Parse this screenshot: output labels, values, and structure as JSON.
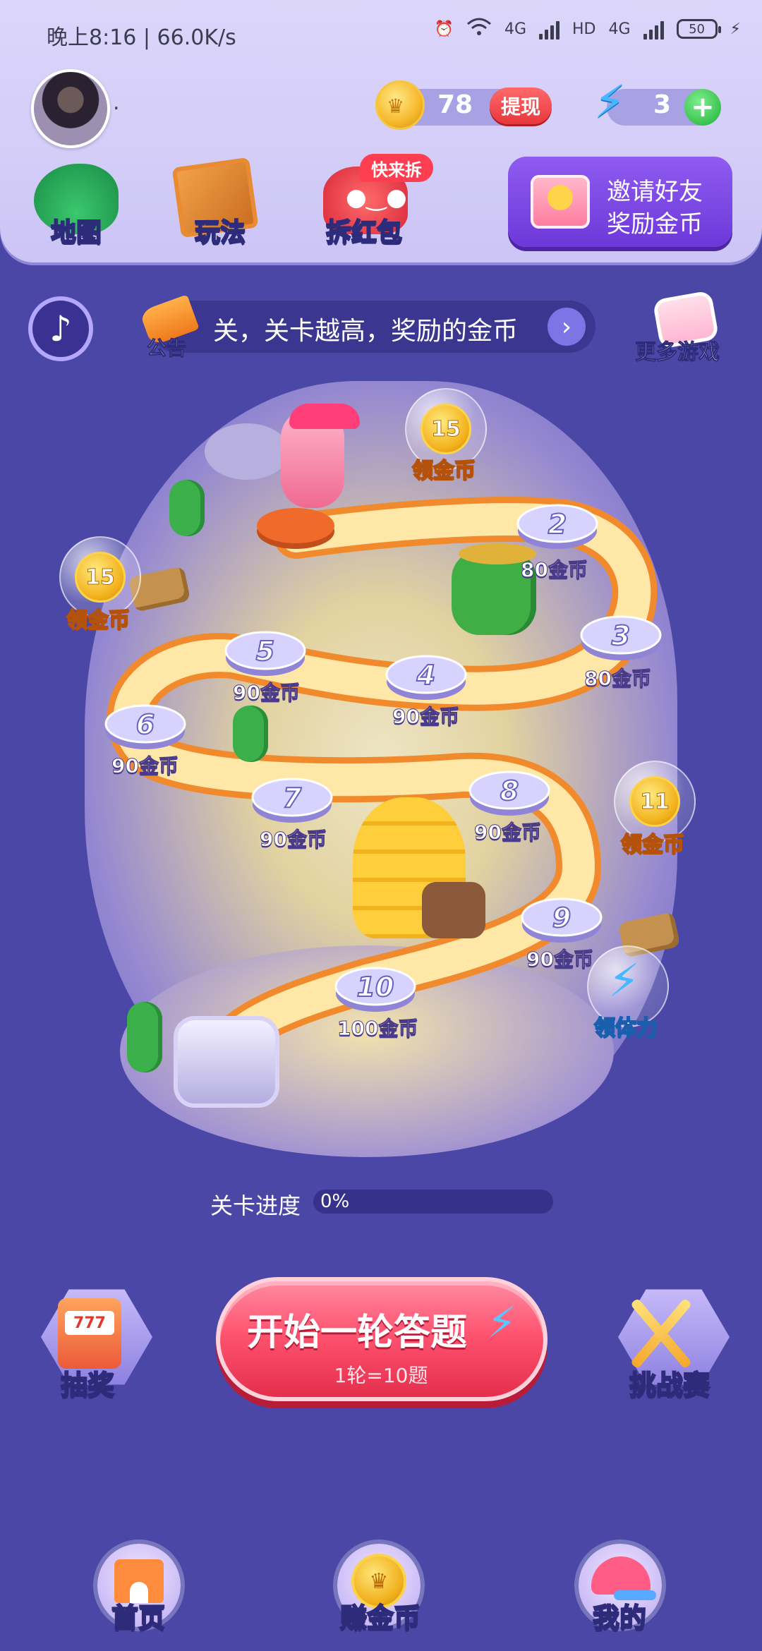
{
  "status_bar": {
    "time_speed": "晚上8:16 | 66.0K/s",
    "network_1": "4G",
    "hd": "HD",
    "network_2": "4G",
    "battery": "50"
  },
  "header": {
    "coins": "78",
    "withdraw_label": "提现",
    "energy": "3",
    "energy_add": "+",
    "avatar_name": "."
  },
  "menu": {
    "map_label": "地图",
    "rules_label": "玩法",
    "redpack_label": "拆红包",
    "redpack_tag": "快来拆"
  },
  "invite": {
    "line1": "邀请好友",
    "line2": "奖励金币"
  },
  "notice": {
    "icon_label": "公告",
    "text": "关，关卡越高，奖励的金币",
    "more_games_label": "更多游戏"
  },
  "map": {
    "levels": [
      {
        "number": "2",
        "reward": "80金币"
      },
      {
        "number": "3",
        "reward": "80金币"
      },
      {
        "number": "4",
        "reward": "90金币"
      },
      {
        "number": "5",
        "reward": "90金币"
      },
      {
        "number": "6",
        "reward": "90金币"
      },
      {
        "number": "7",
        "reward": "90金币"
      },
      {
        "number": "8",
        "reward": "90金币"
      },
      {
        "number": "9",
        "reward": "90金币"
      },
      {
        "number": "10",
        "reward": "100金币"
      }
    ],
    "bonus_bubbles": [
      {
        "value": "15",
        "label": "领金币"
      },
      {
        "value": "15",
        "label": "领金币"
      },
      {
        "value": "11",
        "label": "领金币"
      }
    ],
    "energy_bubble_label": "领体力"
  },
  "progress": {
    "label": "关卡进度",
    "value_text": "0%",
    "fraction": 0
  },
  "actions": {
    "lottery_label": "抽奖",
    "slot_text": "777",
    "start_title": "开始一轮答题",
    "start_sub": "1轮=10题",
    "challenge_label": "挑战赛"
  },
  "nav": {
    "home_label": "首页",
    "earn_label": "赚金币",
    "mine_label": "我的"
  },
  "colors": {
    "background": "#4a47a6",
    "accent_red": "#e8373d",
    "coin_gold": "#f6b92b",
    "energy_blue": "#47b7ff"
  }
}
